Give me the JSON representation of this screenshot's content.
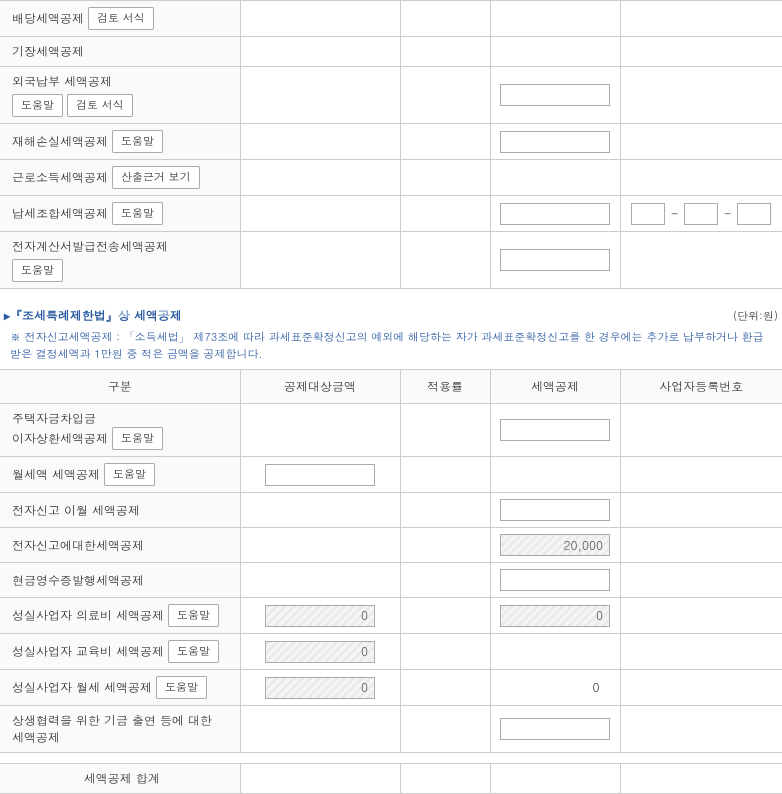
{
  "buttons": {
    "help": "도움말",
    "review_form": "검토 서식",
    "view_basis": "산출근거 보기"
  },
  "table1": {
    "rows": {
      "dividend": "배당세액공제",
      "bookkeeping": "기장세액공제",
      "foreign": "외국납부 세액공제",
      "disaster": "재해손실세액공제",
      "earned_income": "근로소득세액공제",
      "tax_union": "납세조합세액공제",
      "e_invoice": "전자계산서발급전송세액공제"
    }
  },
  "section": {
    "title": "▸『조세특례제한법』상 세액공제",
    "unit": "(단위:원)",
    "note": "※ 전자신고세액공제 : 「소득세법」 제73조에 따라 과세표준확정신고의 예외에 해당하는 자가 과세표준확정신고를 한 경우에는 추가로 납부하거나 환급받은 결정세액과 1만원 중 적은 금액을 공제합니다."
  },
  "headers": {
    "gubun": "구분",
    "amount": "공제대상금액",
    "rate": "적용률",
    "deduction": "세액공제",
    "bizno": "사업자등록번호"
  },
  "table2": {
    "rows": {
      "housing_loan_1": "주택자금차입금",
      "housing_loan_2": "이자상환세액공제",
      "monthly_rent": "월세액 세액공제",
      "efile_carryover": "전자신고 이월 세액공제",
      "efile_deduction": "전자신고에대한세액공제",
      "cash_receipt": "현금영수증발행세액공제",
      "honest_medical": "성실사업자 의료비 세액공제",
      "honest_education": "성실사업자 교육비 세액공제",
      "honest_rent": "성실사업자 월세 세액공제",
      "mutual_fund_1": "상생협력을 위한 기금 출연 등에 대한",
      "mutual_fund_2": "세액공제"
    },
    "values": {
      "efile_deduction": "20,000",
      "honest_medical_amt": "0",
      "honest_medical_ded": "0",
      "honest_education_amt": "0",
      "honest_rent_amt": "0",
      "honest_rent_ded": "0"
    }
  },
  "total": {
    "label": "세액공제 합계"
  }
}
